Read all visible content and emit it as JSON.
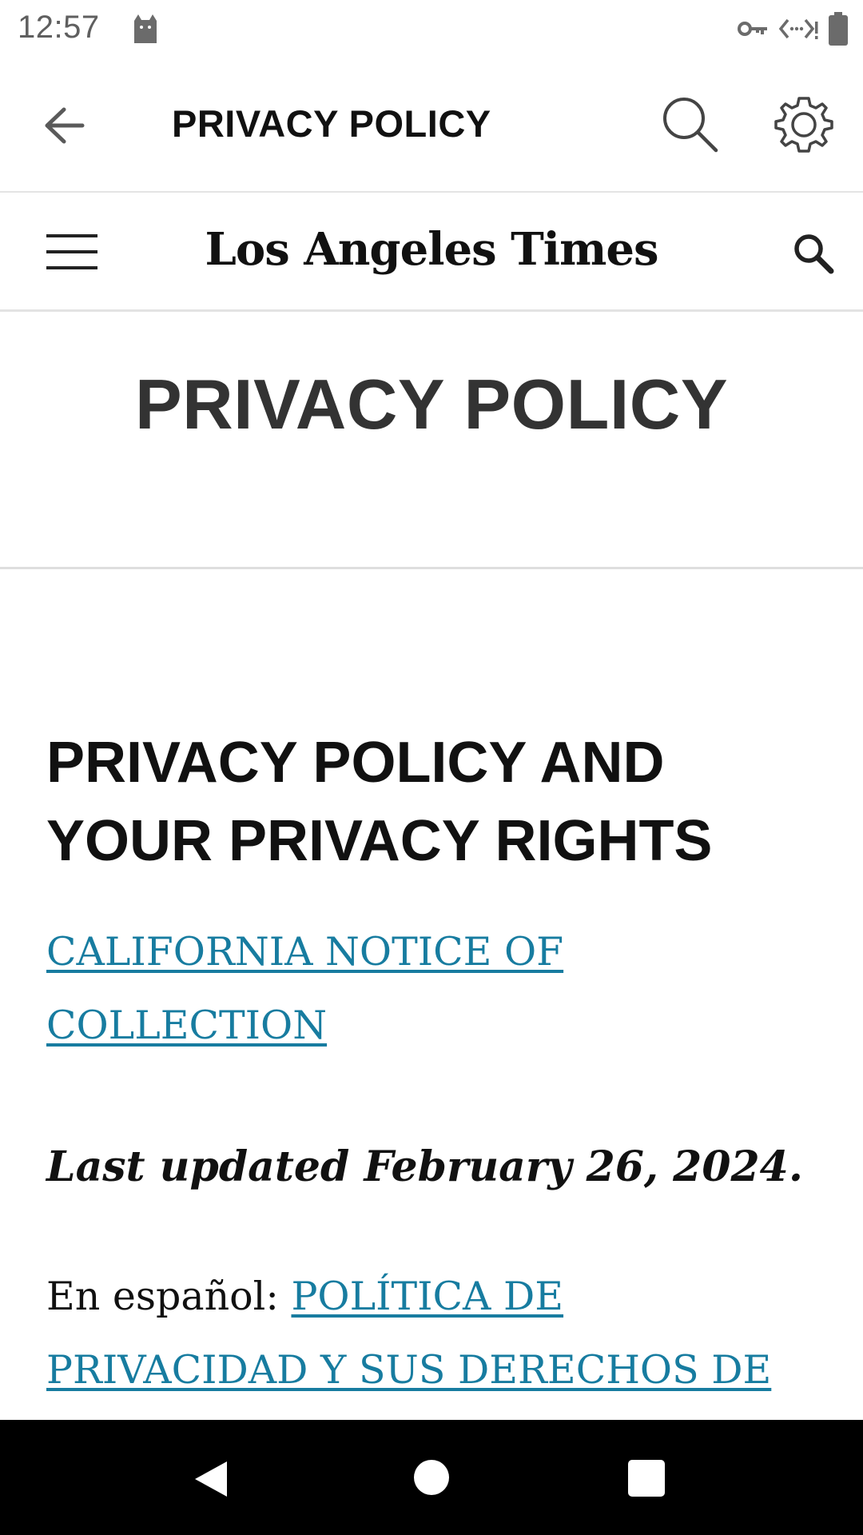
{
  "status_bar": {
    "time": "12:57",
    "icons": [
      "cat-notification-icon",
      "vpn-key-icon",
      "data-saver-icon",
      "battery-icon"
    ]
  },
  "toolbar": {
    "title": "PRIVACY POLICY",
    "icons": [
      "back-arrow-icon",
      "search-icon",
      "gear-icon"
    ]
  },
  "site_header": {
    "masthead": "Los Angeles Times",
    "icons": [
      "hamburger-menu-icon",
      "search-icon"
    ]
  },
  "page": {
    "heading": "PRIVACY POLICY"
  },
  "article": {
    "heading_line1": "PRIVACY POLICY AND",
    "heading_line2": "YOUR PRIVACY RIGHTS",
    "notice_link_line1": "CALIFORNIA NOTICE OF",
    "notice_link_line2": "COLLECTION",
    "updated": "Last updated February 26, 2024.",
    "espanol_prefix": "En español: ",
    "espanol_link": "POLÍTICA DE PRIVACIDAD Y SUS DERECHOS DE"
  },
  "nav_bar": {
    "icons": [
      "nav-back-icon",
      "nav-home-icon",
      "nav-recents-icon"
    ]
  },
  "colors": {
    "link": "#177ca0",
    "text": "#111111",
    "page_heading": "#333333",
    "divider": "#dedede",
    "nav_bar": "#000000"
  }
}
